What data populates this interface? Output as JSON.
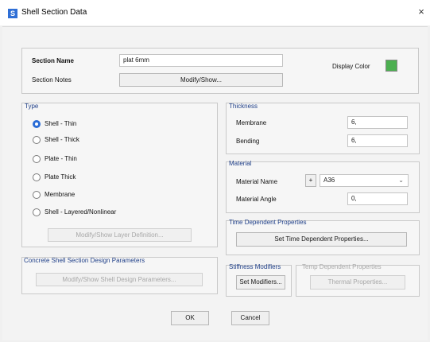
{
  "window": {
    "title": "Shell Section Data",
    "icon_letter": "S",
    "close_glyph": "×"
  },
  "section": {
    "name_label": "Section Name",
    "name_value": "plat 6mm",
    "notes_label": "Section Notes",
    "notes_button": "Modify/Show...",
    "display_color_label": "Display Color",
    "display_color": "#4caf50"
  },
  "type": {
    "title": "Type",
    "options": [
      "Shell - Thin",
      "Shell - Thick",
      "Plate - Thin",
      "Plate Thick",
      "Membrane",
      "Shell - Layered/Nonlinear"
    ],
    "selected": "Shell - Thin",
    "layer_button": "Modify/Show Layer Definition..."
  },
  "concrete": {
    "title": "Concrete Shell Section Design Parameters",
    "button": "Modify/Show Shell Design Parameters..."
  },
  "thickness": {
    "title": "Thickness",
    "membrane_label": "Membrane",
    "membrane_value": "6,",
    "bending_label": "Bending",
    "bending_value": "6,"
  },
  "material": {
    "title": "Material",
    "name_label": "Material Name",
    "plus": "+",
    "name_value": "A36",
    "angle_label": "Material Angle",
    "angle_value": "0,"
  },
  "time_dependent": {
    "title": "Time Dependent Properties",
    "button": "Set Time Dependent Properties..."
  },
  "stiffness": {
    "title": "Stiffness Modifiers",
    "button": "Set Modifiers..."
  },
  "temp_dependent": {
    "title": "Temp Dependent Properties",
    "button": "Thermal Properties..."
  },
  "footer": {
    "ok": "OK",
    "cancel": "Cancel"
  }
}
